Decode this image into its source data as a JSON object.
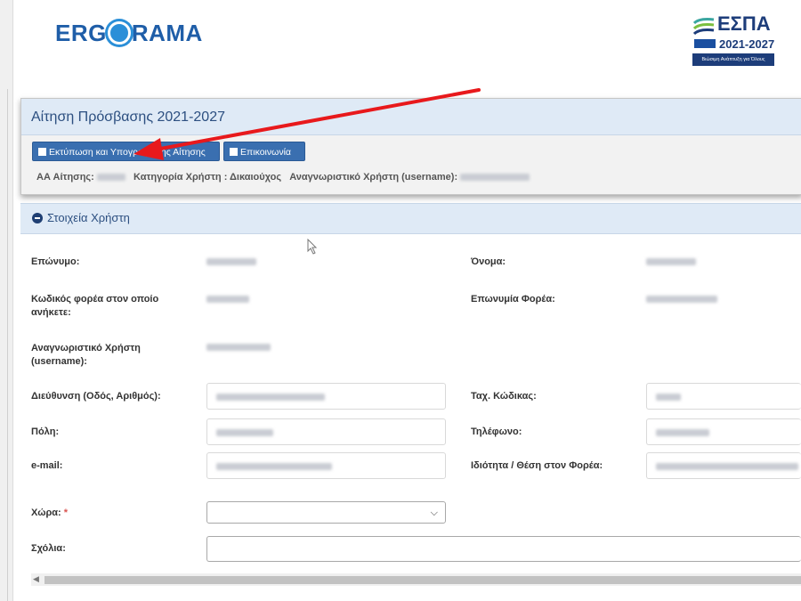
{
  "brand": {
    "logo_left": "ERG",
    "logo_right": "RAMA",
    "espa_title": "ΕΣΠΑ",
    "espa_year": "2021-2027",
    "espa_slogan": "Βιώσιμη Ανάπτυξη για Όλους"
  },
  "application": {
    "title": "Αίτηση Πρόσβασης 2021-2027",
    "print_button": "Εκτύπωση και Υπογραφή της Αίτησης",
    "contact_button": "Επικοινωνία",
    "aa_label": "ΑΑ Αίτησης:",
    "category_label": "Κατηγορία Χρήστη : Δικαιούχος",
    "username_label": "Αναγνωριστικό Χρήστη (username):"
  },
  "user_section": {
    "title": "Στοιχεία Χρήστη",
    "fields": {
      "surname": "Επώνυμο:",
      "name": "Όνομα:",
      "org_code": "Κωδικός φορέα στον οποίο ανήκετε:",
      "org_name": "Επωνυμία Φορέα:",
      "username": "Αναγνωριστικό Χρήστη (username):",
      "address": "Διεύθυνση (Οδός, Αριθμός):",
      "postal_code": "Ταχ. Κώδικας:",
      "city": "Πόλη:",
      "phone": "Τηλέφωνο:",
      "email": "e-mail:",
      "position": "Ιδιότητα / Θέση στον Φορέα:",
      "country": "Χώρα:",
      "country_required": "*",
      "comments": "Σχόλια:"
    }
  },
  "colors": {
    "accent": "#3a6fb0",
    "panel_header": "#dfeaf6",
    "arrow": "#e8191c"
  },
  "icons": {
    "print": "save-icon",
    "contact": "envelope-icon",
    "collapse": "minus-circle-icon",
    "select": "chevron-down-icon"
  }
}
